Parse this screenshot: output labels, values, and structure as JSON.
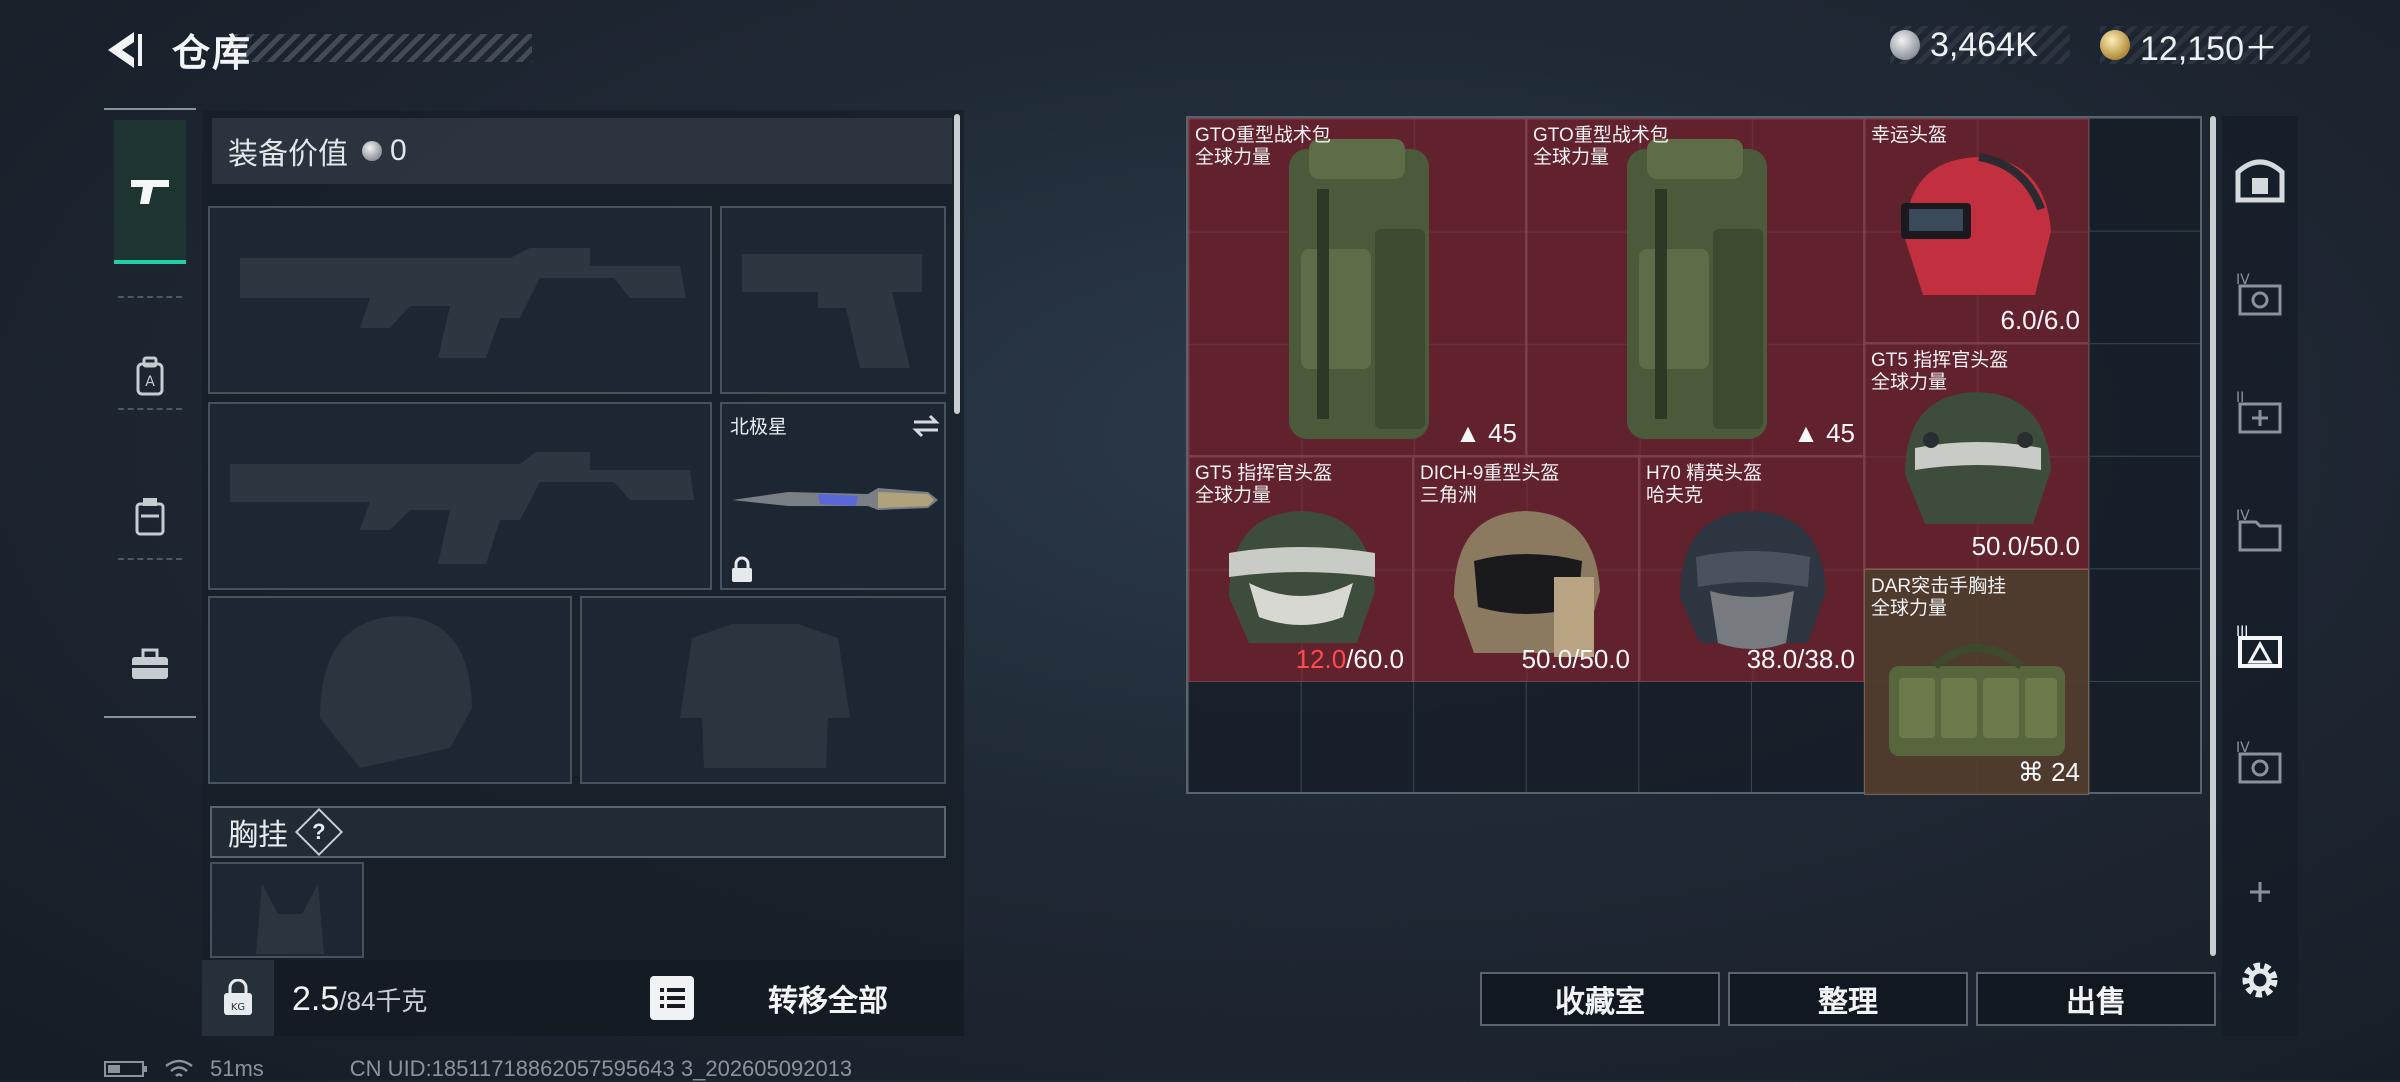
{
  "header": {
    "title": "仓库",
    "currency": [
      {
        "icon": "silver-coin-icon",
        "value": "3,464K"
      },
      {
        "icon": "gold-coin-icon",
        "value": "12,150＋"
      }
    ]
  },
  "left_tabs": [
    {
      "icon": "pistol-icon",
      "active": true
    },
    {
      "icon": "backpack-icon",
      "active": false
    },
    {
      "icon": "storage-case-icon",
      "active": false
    },
    {
      "icon": "toolbox-icon",
      "active": false
    }
  ],
  "equipment": {
    "value_label": "装备价值",
    "value": "0",
    "melee": {
      "name": "北极星"
    },
    "chest_rig_label": "胸挂",
    "help": "?"
  },
  "bottom_bar": {
    "weight_current": "2.5",
    "weight_max": "/84千克",
    "transfer_all": "转移全部"
  },
  "items": [
    {
      "name": "GTO重型战术包",
      "sub": "全球力量",
      "stat": "45",
      "stat_icon": "capacity-icon"
    },
    {
      "name": "GTO重型战术包",
      "sub": "全球力量",
      "stat": "45",
      "stat_icon": "capacity-icon"
    },
    {
      "name": "幸运头盔",
      "sub": "",
      "stat": "6.0/6.0"
    },
    {
      "name": "GT5 指挥官头盔",
      "sub": "全球力量",
      "stat": "50.0/50.0"
    },
    {
      "name": "GT5 指挥官头盔",
      "sub": "全球力量",
      "stat_low": "12.0",
      "stat": "/60.0"
    },
    {
      "name": "DICH-9重型头盔",
      "sub": "三角洲",
      "stat": "50.0/50.0"
    },
    {
      "name": "H70 精英头盔",
      "sub": "哈夫克",
      "stat": "38.0/38.0"
    },
    {
      "name": "DAR突击手胸挂",
      "sub": "全球力量",
      "stat": "24",
      "stat_icon": "vest-capacity-icon"
    }
  ],
  "actions": {
    "collection": "收藏室",
    "sort": "整理",
    "sell": "出售"
  },
  "side_icons": [
    "safe-box-icon",
    "container-iv-icon",
    "container-ii-add-icon",
    "container-iv-folder-icon",
    "container-iii-active-icon",
    "container-iv-icon",
    "add-icon",
    "settings-icon"
  ],
  "status_bar": {
    "ping": "51ms",
    "uid": "CN UID:18511718862057595643 3_202605092013"
  },
  "colors": {
    "accent": "#1fd1a4",
    "item_red": "#69212d",
    "item_brown": "#543e2e",
    "low_value": "#ff4b4b"
  }
}
